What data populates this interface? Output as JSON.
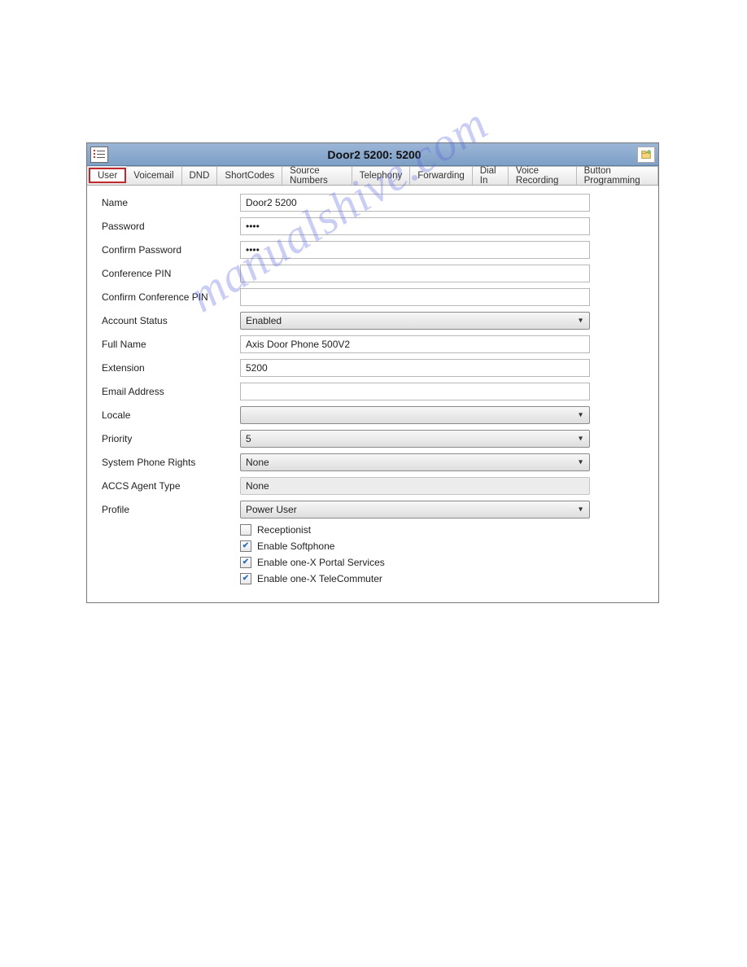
{
  "titlebar": {
    "title": "Door2 5200: 5200"
  },
  "tabs": [
    {
      "label": "User",
      "active": true
    },
    {
      "label": "Voicemail"
    },
    {
      "label": "DND"
    },
    {
      "label": "ShortCodes"
    },
    {
      "label": "Source Numbers"
    },
    {
      "label": "Telephony"
    },
    {
      "label": "Forwarding"
    },
    {
      "label": "Dial In"
    },
    {
      "label": "Voice Recording"
    },
    {
      "label": "Button Programming"
    }
  ],
  "form": {
    "labels": {
      "name": "Name",
      "password": "Password",
      "confirm_password": "Confirm Password",
      "conference_pin": "Conference PIN",
      "confirm_conference_pin": "Confirm Conference PIN",
      "account_status": "Account Status",
      "full_name": "Full Name",
      "extension": "Extension",
      "email": "Email Address",
      "locale": "Locale",
      "priority": "Priority",
      "system_phone_rights": "System Phone Rights",
      "accs_agent_type": "ACCS Agent Type",
      "profile": "Profile"
    },
    "values": {
      "name": "Door2 5200",
      "password": "••••",
      "confirm_password": "••••",
      "conference_pin": "",
      "confirm_conference_pin": "",
      "account_status": "Enabled",
      "full_name": "Axis Door Phone 500V2",
      "extension": "5200",
      "email": "",
      "locale": "",
      "priority": "5",
      "system_phone_rights": "None",
      "accs_agent_type": "None",
      "profile": "Power User"
    },
    "checks": {
      "receptionist": {
        "label": "Receptionist",
        "checked": false
      },
      "softphone": {
        "label": "Enable Softphone",
        "checked": true
      },
      "onex_portal": {
        "label": "Enable one-X Portal Services",
        "checked": true
      },
      "onex_telecommuter": {
        "label": "Enable one-X TeleCommuter",
        "checked": true
      }
    }
  },
  "watermark": "manualshive.com"
}
